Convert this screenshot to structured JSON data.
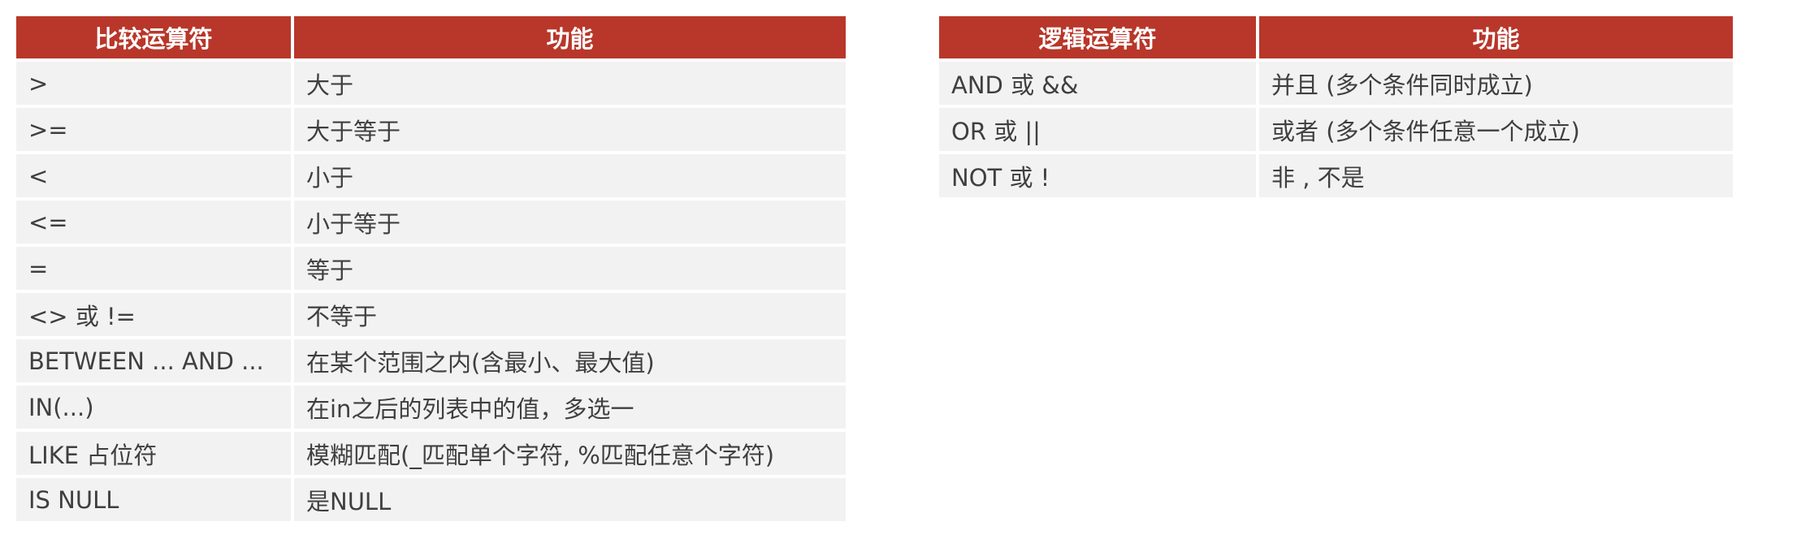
{
  "comparison_table": {
    "headers": [
      "比较运算符",
      "功能"
    ],
    "rows": [
      [
        ">",
        "大于"
      ],
      [
        ">=",
        "大于等于"
      ],
      [
        "<",
        "小于"
      ],
      [
        "<=",
        "小于等于"
      ],
      [
        "=",
        "等于"
      ],
      [
        "<> 或 !=",
        "不等于"
      ],
      [
        "BETWEEN ... AND ...",
        "在某个范围之内(含最小、最大值)"
      ],
      [
        "IN(...)",
        "在in之后的列表中的值，多选一"
      ],
      [
        "LIKE  占位符",
        "模糊匹配(_匹配单个字符, %匹配任意个字符)"
      ],
      [
        "IS NULL",
        "是NULL"
      ]
    ]
  },
  "logic_table": {
    "headers": [
      "逻辑运算符",
      "功能"
    ],
    "rows": [
      [
        "AND  或  &&",
        "并且 (多个条件同时成立)"
      ],
      [
        "OR  或  ||",
        "或者 (多个条件任意一个成立)"
      ],
      [
        "NOT  或  !",
        "非 , 不是"
      ]
    ]
  },
  "colors": {
    "header_bg": "#b8372a",
    "header_text": "#ffffff",
    "cell_bg": "#f2f2f2",
    "cell_text": "#3f3f3f"
  }
}
